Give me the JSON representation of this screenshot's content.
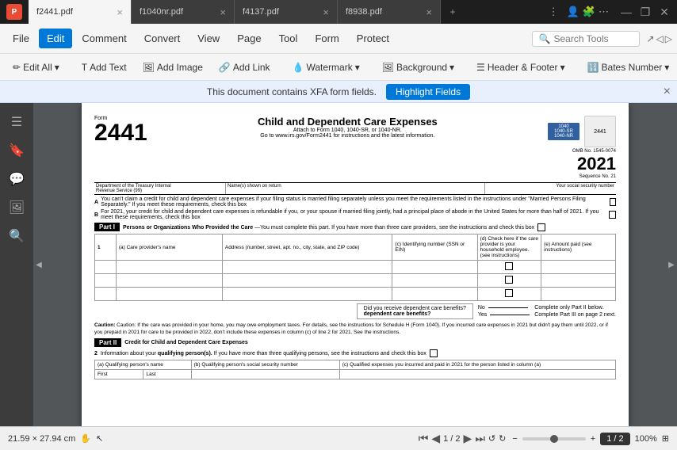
{
  "titleBar": {
    "logo": "P",
    "tabs": [
      {
        "label": "f2441.pdf",
        "active": true
      },
      {
        "label": "f1040nr.pdf",
        "active": false
      },
      {
        "label": "f4137.pdf",
        "active": false
      },
      {
        "label": "f8938.pdf",
        "active": false
      }
    ],
    "addTab": "+",
    "windowControls": {
      "overflow": "⋮",
      "minimize": "",
      "restore": "",
      "close": ""
    }
  },
  "menuBar": {
    "items": [
      {
        "label": "File",
        "active": false
      },
      {
        "label": "Edit",
        "active": true
      },
      {
        "label": "Comment",
        "active": false
      },
      {
        "label": "Convert",
        "active": false
      },
      {
        "label": "View",
        "active": false
      },
      {
        "label": "Page",
        "active": false
      },
      {
        "label": "Tool",
        "active": false
      },
      {
        "label": "Form",
        "active": false
      },
      {
        "label": "Protect",
        "active": false
      }
    ],
    "searchPlaceholder": "Search Tools"
  },
  "toolbar": {
    "items": [
      {
        "label": "✏ Edit All▾"
      },
      {
        "sep": true
      },
      {
        "label": "T Add Text"
      },
      {
        "label": "🖼 Add Image"
      },
      {
        "label": "🔗 Add Link"
      },
      {
        "sep": true
      },
      {
        "label": "💧 Watermark▾"
      },
      {
        "sep": true
      },
      {
        "label": "🖼 Background▾"
      },
      {
        "sep": true
      },
      {
        "label": "☰ Header & Footer▾"
      },
      {
        "sep": true
      },
      {
        "label": "🔢 Bates Number▾"
      },
      {
        "label": "▾"
      }
    ]
  },
  "notification": {
    "text": "This document contains XFA form fields.",
    "buttonLabel": "Highlight Fields",
    "closeIcon": "×"
  },
  "sidebar": {
    "icons": [
      "☰",
      "🔖",
      "💬",
      "🖼",
      "🔍"
    ]
  },
  "document": {
    "formNumber": "2441",
    "formLabel": "Form",
    "title": "Child and Dependent Care Expenses",
    "subtitle1": "Attach to Form 1040, 1040-SR, or 1040-NR.",
    "subtitle2": "Go to www.irs.gov/Form2441 for instructions and the latest information.",
    "ombNumber": "OMB No. 1545-0074",
    "year": "2021",
    "sequenceNo": "Sequence No. 21",
    "dept1": "Department of the Treasury Internal",
    "dept2": "Revenue Service (99)",
    "nameLabel": "Name(s) shown on return",
    "ssnLabel": "Your social security number",
    "sectionA": {
      "label": "A",
      "text": "You can't claim a credit for child and dependent care expenses if your filing status is married filing separately unless you meet the requirements listed in the instructions under \"Married Persons Filing Separately.\" If you meet these requirements, check this box"
    },
    "sectionB": {
      "label": "B",
      "text": "For 2021, your credit for child and dependent care expenses is refundable if you, or your spouse if married filing jointly, had a principal place of abode in the United States for more than half of 2021. If you meet these requirements, check this box"
    },
    "part1": {
      "label": "Part I",
      "title": "Persons or Organizations Who Provided the Care",
      "subtitle": "—You must complete this part.",
      "note": "If you have more than three care providers, see the instructions and check this box",
      "row1": "1",
      "colA": "(a) Care provider's name",
      "colB": "Address (number, street, apt. no., city, state, and ZIP code)",
      "colC": "(c) Identifying number (SSN or EIN)",
      "colD": "(d) Check here if the care provider is your household employee. (see instructions)",
      "colE": "(e) Amount paid (see instructions)",
      "question": "Did you receive dependent care benefits?",
      "no": "No",
      "yes": "Yes",
      "completeOnly2": "Complete only Part II below.",
      "completePart3": "Complete Part III on page 2 next."
    },
    "caution": "Caution: If the care was provided in your home, you may owe employment taxes. For details, see the instructions for Schedule H (Form 1040). If you incurred care expenses in 2021 but didn't pay them until 2022, or if you prepaid in 2021 for care to be provided in 2022, don't include these expenses in column (c) of line 2 for 2021. See the instructions.",
    "part2": {
      "label": "Part II",
      "title": "Credit for Child and Dependent Care Expenses",
      "row2": "2",
      "text2": "Information about your qualifying person(s). If you have more than three qualifying persons, see the instructions and check this box",
      "colA2": "(a) Qualifying person's name",
      "colFirst": "First",
      "colLast": "Last",
      "colB2": "(b) Qualifying person's social security number",
      "colC2": "(c) Qualified expenses you incurred and paid in 2021 for the person listed in column (a)"
    }
  },
  "statusBar": {
    "dimensions": "21.59 × 27.94 cm",
    "handIcon": "✋",
    "arrowIcon": "↖",
    "prevPage": "◀",
    "firstPage": "⏮",
    "pageInfo": "1 / 2",
    "nextPage": "▶",
    "lastPage": "⏭",
    "rotateLeft": "↺",
    "rotateRight": "↻",
    "zoomOut": "−",
    "zoomIn": "+",
    "zoomLevel": "100%",
    "fitIcon": "⊞"
  }
}
